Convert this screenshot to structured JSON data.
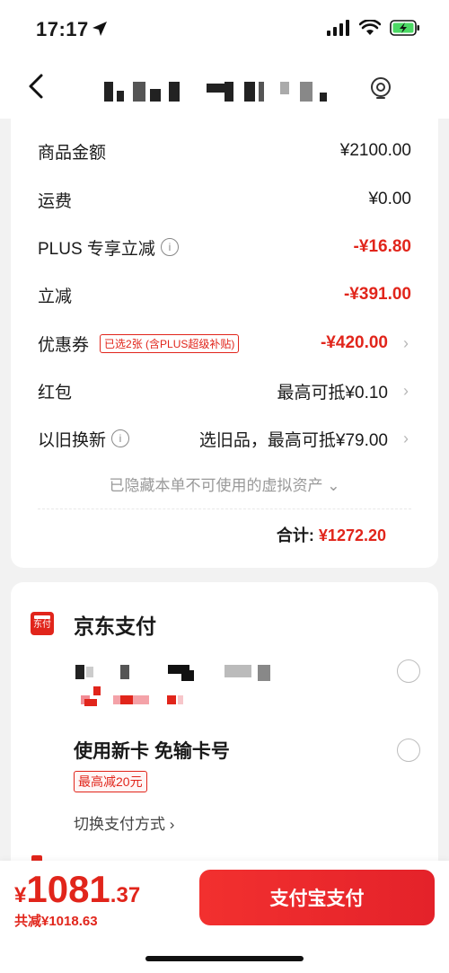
{
  "status_bar": {
    "time": "17:17"
  },
  "summary": {
    "rows": [
      {
        "label": "商品金额",
        "value": "¥2100.00"
      },
      {
        "label": "运费",
        "value": "¥0.00"
      },
      {
        "label": "PLUS 专享立减",
        "value": "-¥16.80"
      },
      {
        "label": "立减",
        "value": "-¥391.00"
      },
      {
        "label": "优惠券",
        "tag": "已选2张 (含PLUS超级补贴)",
        "value": "-¥420.00"
      },
      {
        "label": "红包",
        "value": "最高可抵¥0.10"
      },
      {
        "label": "以旧换新",
        "value": "选旧品，最高可抵¥79.00"
      }
    ],
    "hidden_note": "已隐藏本单不可使用的虚拟资产 ⌄",
    "total_label": "合计:",
    "total_value": "¥1272.20"
  },
  "payment": {
    "title": "京东支付",
    "icon_text": "东付",
    "new_card_title": "使用新卡 免输卡号",
    "new_card_tag": "最高减20元",
    "switch_label": "切换支付方式 ›"
  },
  "bottom": {
    "currency": "¥",
    "price_int": "1081",
    "price_dec": ".37",
    "saved": "共减¥1018.63",
    "pay_button": "支付宝支付"
  },
  "colors": {
    "accent": "#e1251b",
    "background": "#f2f2f2"
  }
}
